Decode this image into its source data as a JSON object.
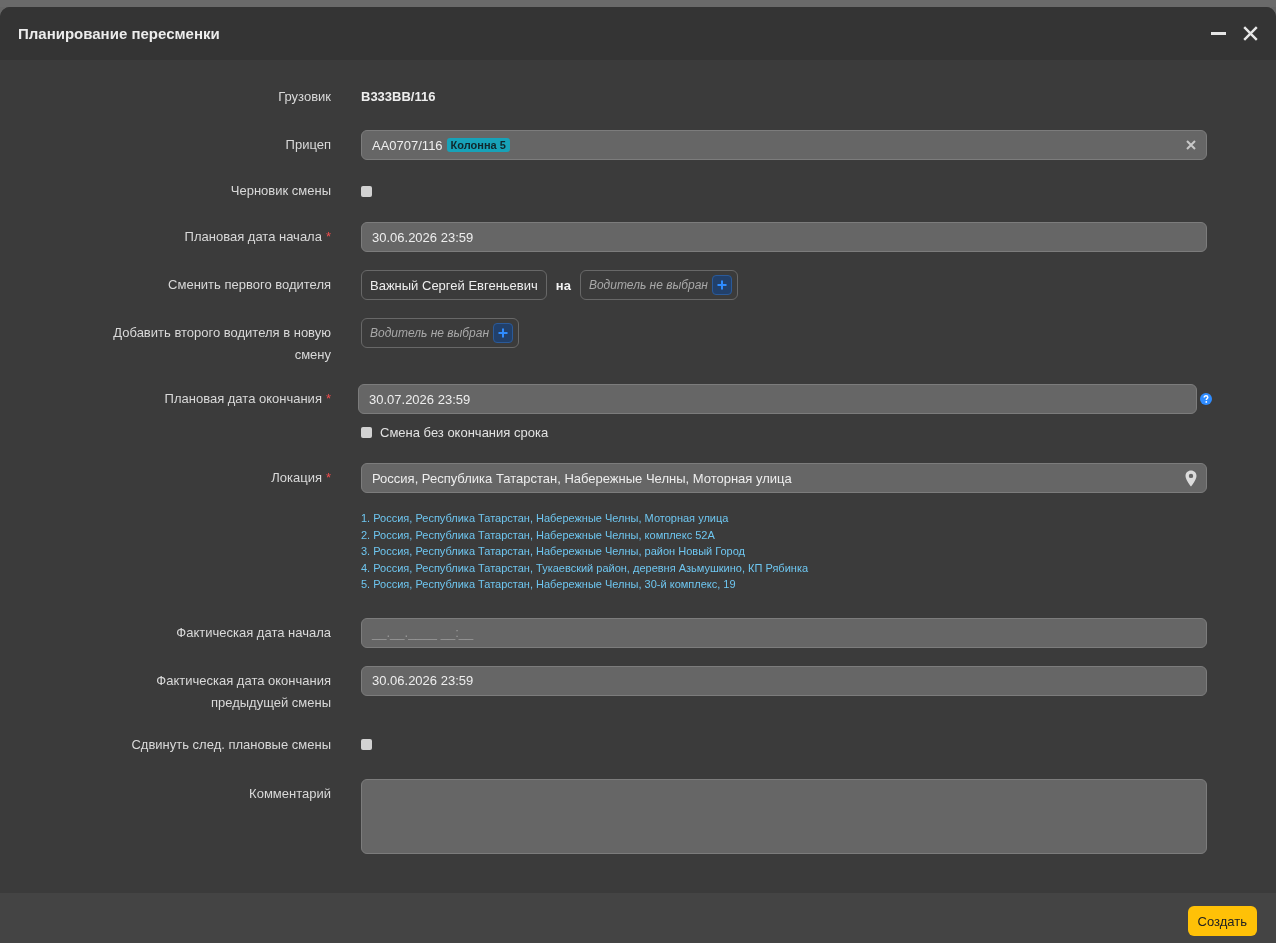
{
  "window": {
    "title": "Планирование пересменки"
  },
  "form": {
    "rows": [
      {
        "kind": "text",
        "label": "Грузовик",
        "value": "В333ВВ/116"
      },
      {
        "kind": "select",
        "label": "Прицеп",
        "value": "АА0707/116",
        "badge": "Колонна 5",
        "clearable": true
      },
      {
        "kind": "checkbox",
        "label": "Черновик смены",
        "checked": false
      },
      {
        "kind": "date",
        "label": "Плановая дата начала",
        "required_mark": "*",
        "value": "30.06.2026 23:59"
      },
      {
        "kind": "driver_swap",
        "label": "Сменить первого водителя",
        "current": "Важный Сергей Евгеньевич",
        "connector": "на",
        "picker": {
          "placeholder": "Водитель не выбран"
        }
      },
      {
        "kind": "driver_add",
        "label": "Добавить второго водителя в новую смену",
        "picker": {
          "placeholder": "Водитель не выбран"
        }
      },
      {
        "kind": "date",
        "label": "Плановая дата окончания",
        "required_mark": "*",
        "value": "30.07.2026 23:59",
        "help": true,
        "option": {
          "label": "Смена без окончания срока",
          "checked": false
        }
      },
      {
        "kind": "location",
        "label": "Локация",
        "required_mark": "*",
        "value": "Россия, Республика Татарстан, Набережные Челны, Моторная улица",
        "suggestions": [
          "1. Россия, Республика Татарстан, Набережные Челны, Моторная улица",
          "2. Россия, Республика Татарстан, Набережные Челны, комплекс 52А",
          "3. Россия, Республика Татарстан, Набережные Челны, район Новый Город",
          "4. Россия, Республика Татарстан, Тукаевский район, деревня Азьмушкино, КП Рябинка",
          "5. Россия, Республика Татарстан, Набережные Челны, 30-й комплекс, 19"
        ]
      },
      {
        "kind": "date",
        "label": "Фактическая дата начала",
        "placeholder": "__.__.____ __:__"
      },
      {
        "kind": "date",
        "label": "Фактическая дата окончания предыдущей смены",
        "value": "30.06.2026 23:59"
      },
      {
        "kind": "checkbox",
        "label": "Сдвинуть след. плановые смены",
        "checked": false
      },
      {
        "kind": "textarea",
        "label": "Комментарий"
      }
    ]
  },
  "footer": {
    "buttons": [
      {
        "label": "Создать",
        "kind": "primary"
      }
    ]
  }
}
